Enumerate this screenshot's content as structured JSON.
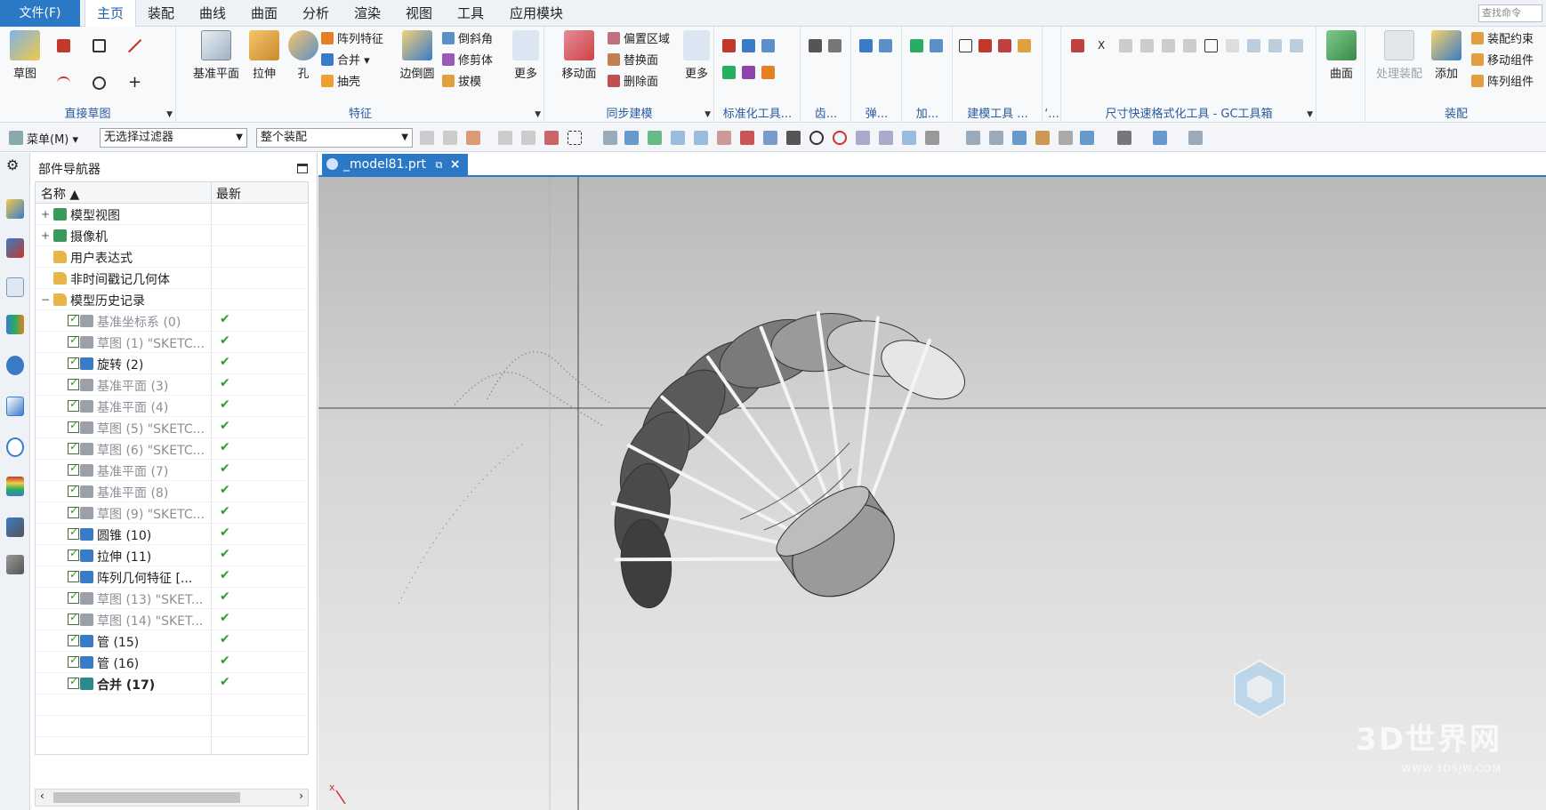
{
  "menubar": {
    "file": "文件(F)",
    "items": [
      "主页",
      "装配",
      "曲线",
      "曲面",
      "分析",
      "渲染",
      "视图",
      "工具",
      "应用模块"
    ],
    "search_placeholder": "查找命令"
  },
  "ribbon": {
    "sketch": {
      "button": "草图",
      "label": "直接草图"
    },
    "feature": {
      "big": [
        "基准平面",
        "拉伸",
        "孔"
      ],
      "col1": [
        "阵列特征",
        "合并",
        "抽壳"
      ],
      "col2_big": "边倒圆",
      "col3": [
        "倒斜角",
        "修剪体",
        "拔模"
      ],
      "more": "更多",
      "label": "特征"
    },
    "sync": {
      "big": "移动面",
      "col": [
        "偏置区域",
        "替换面",
        "删除面"
      ],
      "more": "更多",
      "label": "同步建模"
    },
    "groups": [
      "标准化工具...",
      "齿...",
      "弹...",
      "加...",
      "建模工具 ...",
      "‘..."
    ],
    "gc_label": "尺寸快速格式化工具 - GC工具箱",
    "surface": "曲面",
    "assembly": {
      "big": [
        "处理装配",
        "添加"
      ],
      "col": [
        "装配约束",
        "移动组件",
        "阵列组件"
      ],
      "label": "装配"
    }
  },
  "selbar": {
    "menu": "菜单(M)",
    "filter": "无选择过滤器",
    "scope": "整个装配"
  },
  "navigator": {
    "title": "部件导航器",
    "col_name": "名称",
    "col_latest": "最新",
    "rows": [
      {
        "label": "模型视图",
        "level": 0,
        "kind": "group",
        "expand": "+",
        "check": false
      },
      {
        "label": "摄像机",
        "level": 0,
        "kind": "group",
        "expand": "+",
        "check": false
      },
      {
        "label": "用户表达式",
        "level": 0,
        "kind": "folder",
        "check": false
      },
      {
        "label": "非时间戳记几何体",
        "level": 0,
        "kind": "folder",
        "check": false
      },
      {
        "label": "模型历史记录",
        "level": 0,
        "kind": "folder",
        "expand": "−",
        "check": false
      },
      {
        "label": "基准坐标系 (0)",
        "level": 1,
        "kind": "grey",
        "check": true
      },
      {
        "label": "草图 (1) \"SKETC...",
        "level": 1,
        "kind": "grey",
        "check": true
      },
      {
        "label": "旋转 (2)",
        "level": 1,
        "kind": "normal",
        "check": true
      },
      {
        "label": "基准平面 (3)",
        "level": 1,
        "kind": "grey",
        "check": true
      },
      {
        "label": "基准平面 (4)",
        "level": 1,
        "kind": "grey",
        "check": true
      },
      {
        "label": "草图 (5) \"SKETC...",
        "level": 1,
        "kind": "grey",
        "check": true
      },
      {
        "label": "草图 (6) \"SKETC...",
        "level": 1,
        "kind": "grey",
        "check": true
      },
      {
        "label": "基准平面 (7)",
        "level": 1,
        "kind": "grey",
        "check": true
      },
      {
        "label": "基准平面 (8)",
        "level": 1,
        "kind": "grey",
        "check": true
      },
      {
        "label": "草图 (9) \"SKETC...",
        "level": 1,
        "kind": "grey",
        "check": true
      },
      {
        "label": "圆锥 (10)",
        "level": 1,
        "kind": "normal",
        "check": true
      },
      {
        "label": "拉伸 (11)",
        "level": 1,
        "kind": "normal",
        "check": true
      },
      {
        "label": "阵列几何特征 [...",
        "level": 1,
        "kind": "normal",
        "check": true
      },
      {
        "label": "草图 (13) \"SKET...",
        "level": 1,
        "kind": "grey",
        "check": true
      },
      {
        "label": "草图 (14) \"SKET...",
        "level": 1,
        "kind": "grey",
        "check": true
      },
      {
        "label": "管 (15)",
        "level": 1,
        "kind": "normal",
        "check": true
      },
      {
        "label": "管 (16)",
        "level": 1,
        "kind": "normal",
        "check": true
      },
      {
        "label": "合并 (17)",
        "level": 1,
        "kind": "bold",
        "check": true
      }
    ]
  },
  "graphics": {
    "tab": "_model81.prt",
    "watermark": "3D世界网",
    "watermark_url": "WWW.3DSJW.COM"
  },
  "colors": {
    "accent": "#2b79c6",
    "ok": "#2ca02c"
  }
}
